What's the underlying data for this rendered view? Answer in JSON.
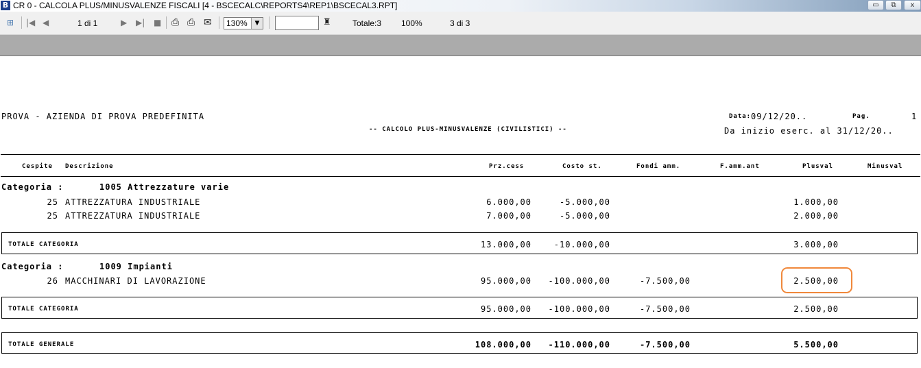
{
  "window": {
    "app_icon_letter": "B",
    "title": "CR 0 - CALCOLA PLUS/MINUSVALENZE FISCALI [4 - BSCECALC\\REPORTS4\\REP1\\BSCECAL3.RPT]",
    "minimize_glyph": "▭",
    "restore_glyph": "⧉",
    "close_glyph": "x"
  },
  "toolbar": {
    "tree_glyph": "⊞",
    "first_glyph": "|◀",
    "prev_glyph": "◀",
    "page_label": "1 di 1",
    "next_glyph": "▶",
    "last_glyph": "▶|",
    "stop_glyph": "■",
    "print_glyph": "⎙",
    "print_setup_glyph": "⎙",
    "export_glyph": "✉",
    "zoom_value": "130%",
    "zoom_arrow": "▼",
    "find_glyph": "♜",
    "total_label": "Totale:3",
    "percent_label": "100%",
    "records_label": "3 di 3"
  },
  "report": {
    "company": "PROVA - AZIENDA DI PROVA PREDEFINITA",
    "subtitle": "-- CALCOLO PLUS-MINUSVALENZE (CIVILISTICI) --",
    "data_label": "Data:",
    "data_value": "09/12/20..",
    "pag_label": "Pag.",
    "pag_value": "1",
    "period": "Da inizio eserc. al 31/12/20..",
    "columns": {
      "cespite": "Cespite",
      "descrizione": "Descrizione",
      "prz_cess": "Prz.cess",
      "costo_st": "Costo st.",
      "fondi_amm": "Fondi amm.",
      "f_amm_ant": "F.amm.ant",
      "plusval": "Plusval",
      "minusval": "Minusval"
    },
    "categories": [
      {
        "label": "Categoria :",
        "code_name": "1005 Attrezzature varie",
        "rows": [
          {
            "cespite": "25",
            "descrizione": "ATTREZZATURA INDUSTRIALE",
            "prz_cess": "6.000,00",
            "costo_st": "-5.000,00",
            "fondi_amm": "",
            "plusval": "1.000,00"
          },
          {
            "cespite": "25",
            "descrizione": "ATTREZZATURA INDUSTRIALE",
            "prz_cess": "7.000,00",
            "costo_st": "-5.000,00",
            "fondi_amm": "",
            "plusval": "2.000,00"
          }
        ],
        "total": {
          "label": "TOTALE CATEGORIA",
          "prz_cess": "13.000,00",
          "costo_st": "-10.000,00",
          "fondi_amm": "",
          "plusval": "3.000,00"
        }
      },
      {
        "label": "Categoria :",
        "code_name": "1009 Impianti",
        "rows": [
          {
            "cespite": "26",
            "descrizione": "MACCHINARI DI LAVORAZIONE",
            "prz_cess": "95.000,00",
            "costo_st": "-100.000,00",
            "fondi_amm": "-7.500,00",
            "plusval": "2.500,00"
          }
        ],
        "total": {
          "label": "TOTALE CATEGORIA",
          "prz_cess": "95.000,00",
          "costo_st": "-100.000,00",
          "fondi_amm": "-7.500,00",
          "plusval": "2.500,00"
        }
      }
    ],
    "grand_total": {
      "label": "TOTALE GENERALE",
      "prz_cess": "108.000,00",
      "costo_st": "-110.000,00",
      "fondi_amm": "-7.500,00",
      "plusval": "5.500,00"
    },
    "highlight_color": "#f0883b"
  }
}
